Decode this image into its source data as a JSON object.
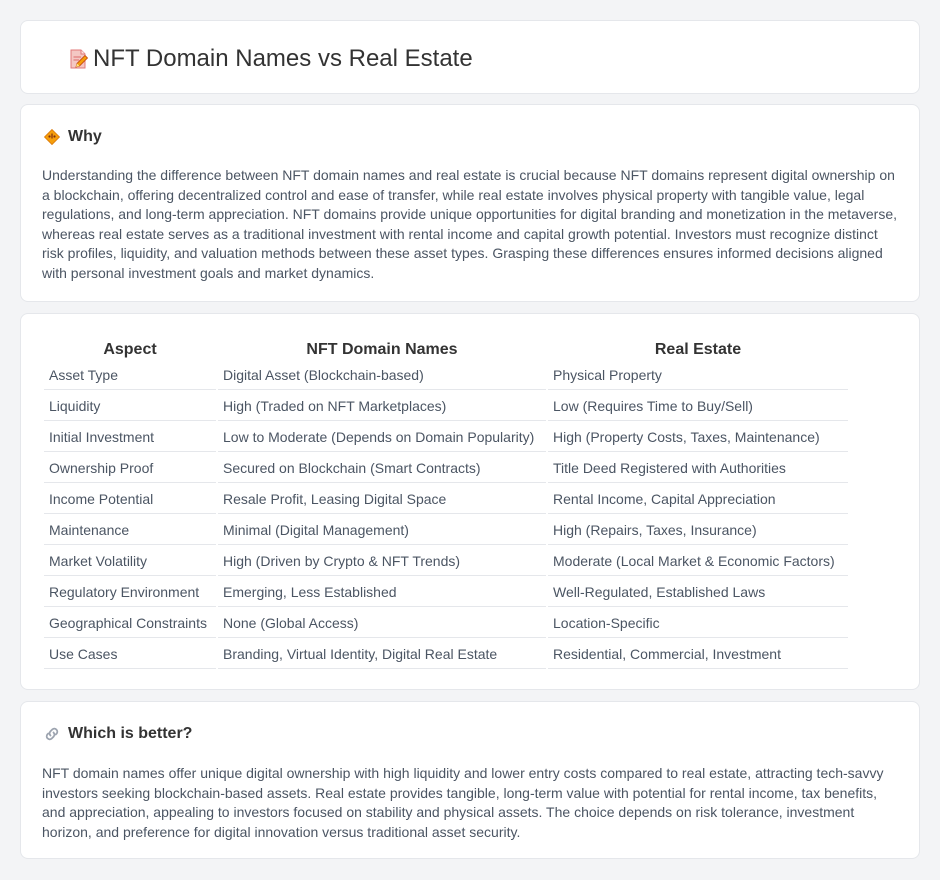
{
  "header": {
    "title": "NFT Domain Names vs Real Estate",
    "icon": "document-pencil-icon"
  },
  "why": {
    "icon": "diamond-warning-icon",
    "title": "Why",
    "text": "Understanding the difference between NFT domain names and real estate is crucial because NFT domains represent digital ownership on a blockchain, offering decentralized control and ease of transfer, while real estate involves physical property with tangible value, legal regulations, and long-term appreciation. NFT domains provide unique opportunities for digital branding and monetization in the metaverse, whereas real estate serves as a traditional investment with rental income and capital growth potential. Investors must recognize distinct risk profiles, liquidity, and valuation methods between these asset types. Grasping these differences ensures informed decisions aligned with personal investment goals and market dynamics."
  },
  "table": {
    "headers": [
      "Aspect",
      "NFT Domain Names",
      "Real Estate"
    ],
    "rows": [
      [
        "Asset Type",
        "Digital Asset (Blockchain-based)",
        "Physical Property"
      ],
      [
        "Liquidity",
        "High (Traded on NFT Marketplaces)",
        "Low (Requires Time to Buy/Sell)"
      ],
      [
        "Initial Investment",
        "Low to Moderate (Depends on Domain Popularity)",
        "High (Property Costs, Taxes, Maintenance)"
      ],
      [
        "Ownership Proof",
        "Secured on Blockchain (Smart Contracts)",
        "Title Deed Registered with Authorities"
      ],
      [
        "Income Potential",
        "Resale Profit, Leasing Digital Space",
        "Rental Income, Capital Appreciation"
      ],
      [
        "Maintenance",
        "Minimal (Digital Management)",
        "High (Repairs, Taxes, Insurance)"
      ],
      [
        "Market Volatility",
        "High (Driven by Crypto & NFT Trends)",
        "Moderate (Local Market & Economic Factors)"
      ],
      [
        "Regulatory Environment",
        "Emerging, Less Established",
        "Well-Regulated, Established Laws"
      ],
      [
        "Geographical Constraints",
        "None (Global Access)",
        "Location-Specific"
      ],
      [
        "Use Cases",
        "Branding, Virtual Identity, Digital Real Estate",
        "Residential, Commercial, Investment"
      ]
    ]
  },
  "better": {
    "icon": "link-icon",
    "title": "Which is better?",
    "text": "NFT domain names offer unique digital ownership with high liquidity and lower entry costs compared to real estate, attracting tech-savvy investors seeking blockchain-based assets. Real estate provides tangible, long-term value with potential for rental income, tax benefits, and appreciation, appealing to investors focused on stability and physical assets. The choice depends on risk tolerance, investment horizon, and preference for digital innovation versus traditional asset security."
  },
  "colors": {
    "background": "#f3f4f6",
    "card": "#ffffff",
    "border": "#e5e7eb",
    "title": "#333333",
    "text": "#4b5563",
    "icon_orange": "#f59e0b",
    "icon_pink": "#e07a7a"
  }
}
